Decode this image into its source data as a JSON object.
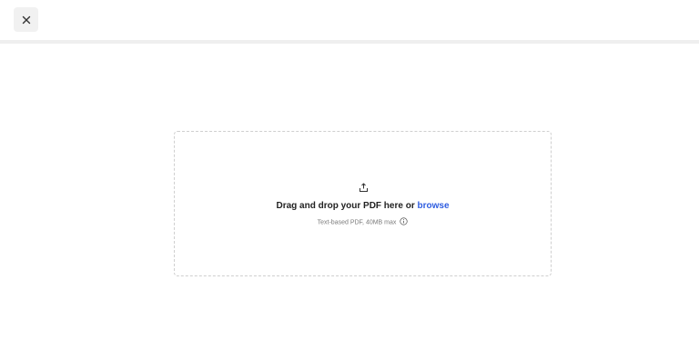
{
  "header": {
    "close_icon": "close-icon"
  },
  "dropzone": {
    "upload_icon": "upload-icon",
    "prompt_text": "Drag and drop your PDF here or ",
    "browse_label": "browse",
    "hint_text": "Text-based PDF, 40MB max",
    "info_icon": "info-icon",
    "link_color": "#2f5de0"
  }
}
